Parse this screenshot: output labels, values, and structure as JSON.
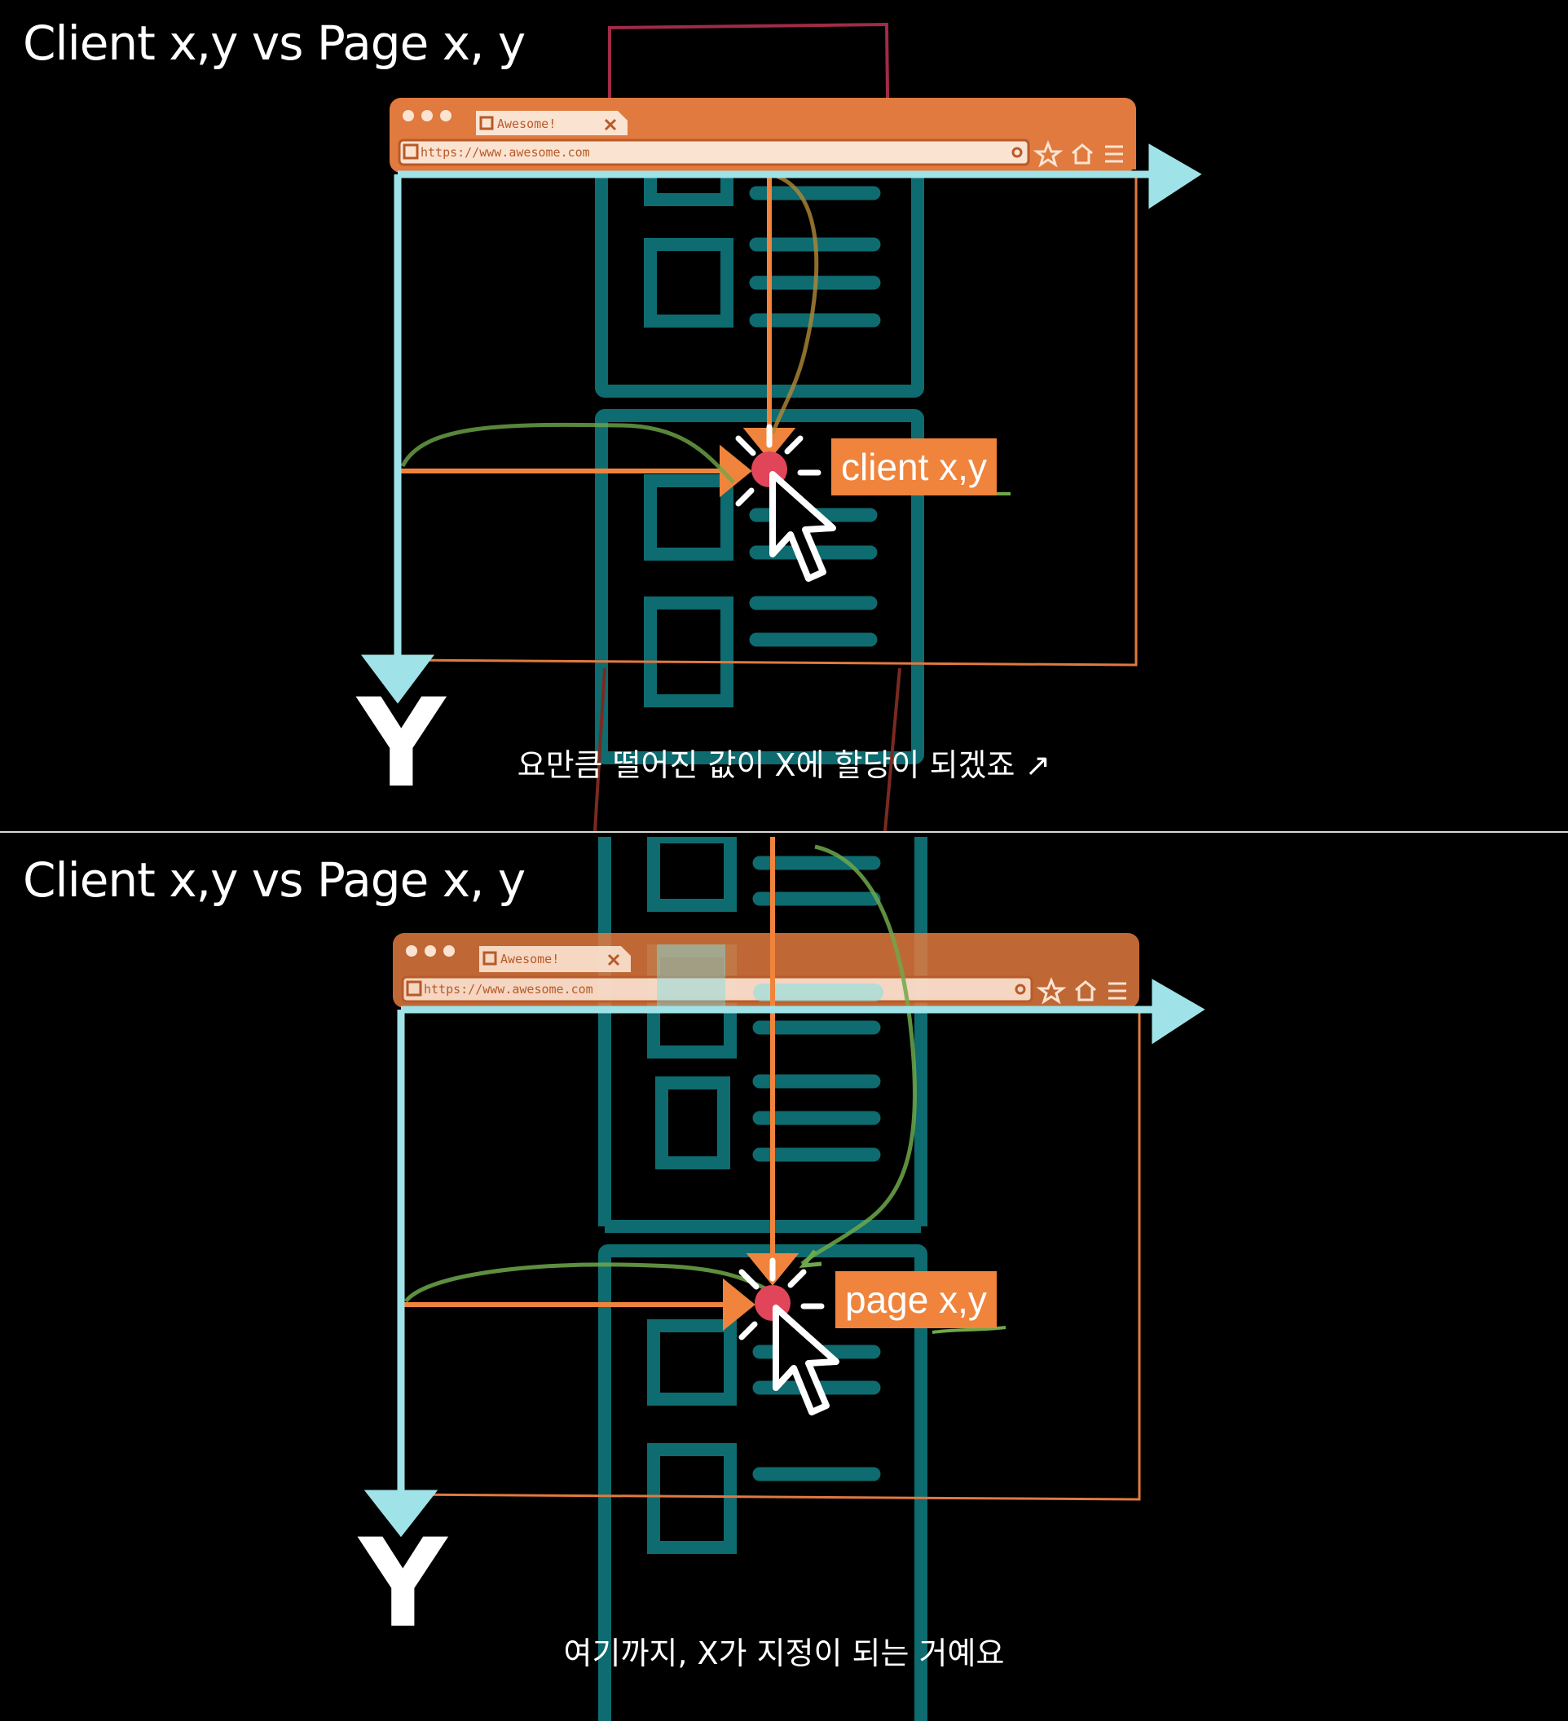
{
  "panels": [
    {
      "title": "Client x,y vs Page x, y",
      "browser": {
        "tab_label": "Awesome!",
        "url": "https://www.awesome.com"
      },
      "point_label": "client x,y",
      "y_axis_letter": "Y",
      "caption": "요만큼 떨어진 값이 X에 할당이 되겠죠 ↗"
    },
    {
      "title": "Client x,y vs Page x, y",
      "browser": {
        "tab_label": "Awesome!",
        "url": "https://www.awesome.com"
      },
      "point_label": "page x,y",
      "y_axis_letter": "Y",
      "caption": "여기까지, X가 지정이 되는 거예요"
    }
  ],
  "colors": {
    "background": "#000000",
    "browser_chrome": "#e07a3e",
    "axis": "#9fe3e8",
    "page_content": "#0e6b70",
    "guide_line": "#f0843c",
    "click_point": "#e0455a",
    "annotation_green": "#6fa84a",
    "annotation_red": "#c8365a"
  }
}
